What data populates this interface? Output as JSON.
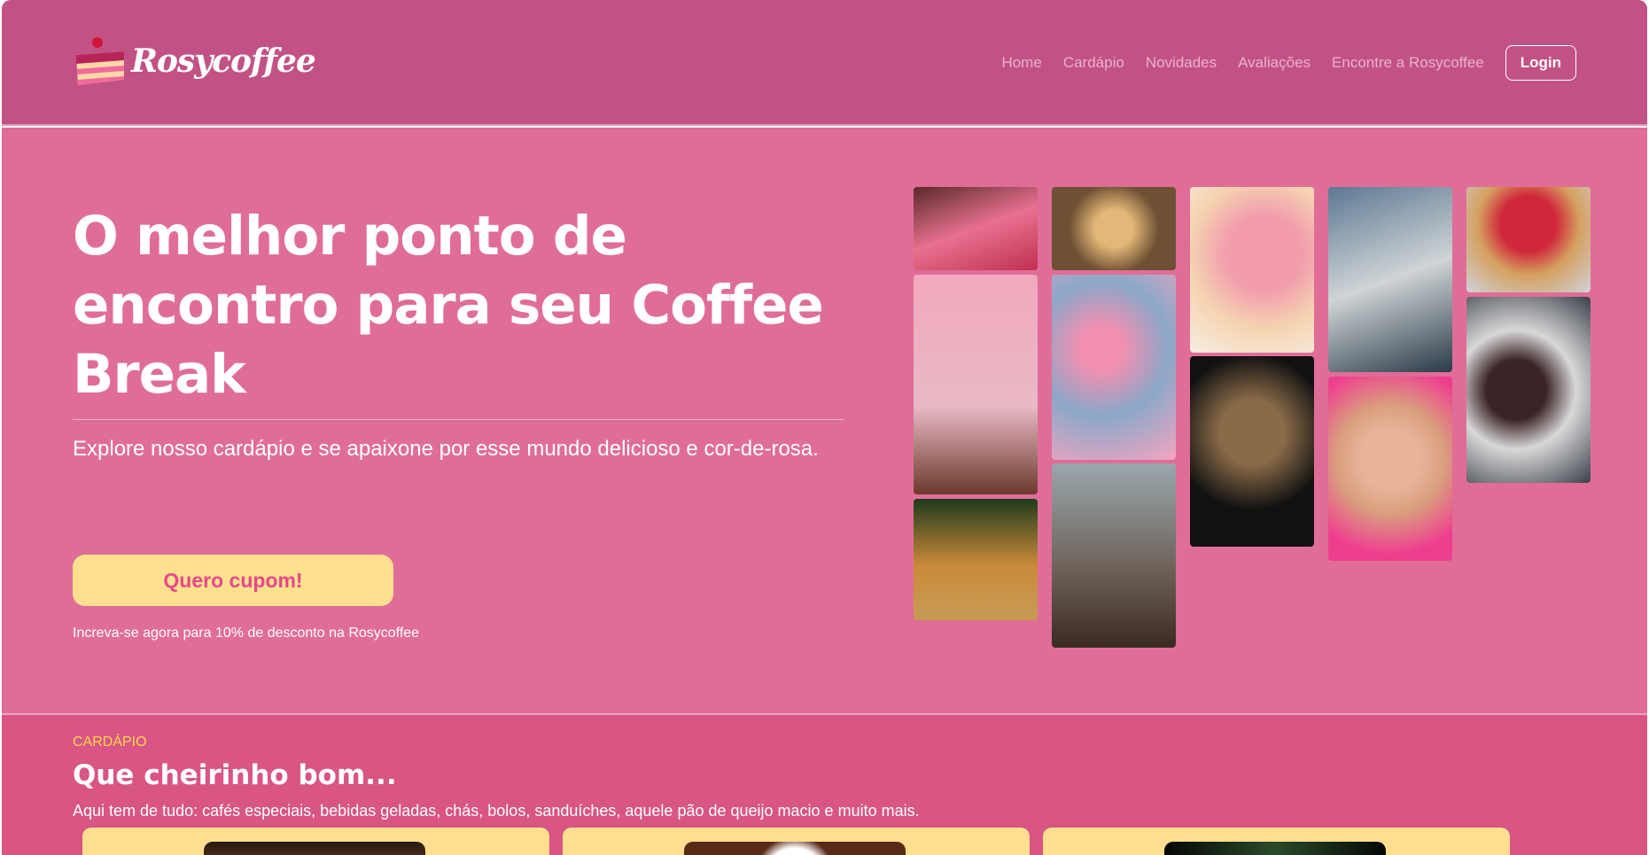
{
  "header": {
    "brand": "Rosycoffee",
    "nav": [
      "Home",
      "Cardápio",
      "Novidades",
      "Avaliações",
      "Encontre a Rosycoffee"
    ],
    "login": "Login"
  },
  "hero": {
    "title": "O melhor ponto de encontro para seu Coffee Break",
    "subtitle": "Explore nosso cardápio e se apaixone por esse mundo delicioso e cor-de-rosa.",
    "cta": "Quero cupom!",
    "note": "Increva-se agora para 10% de desconto na Rosycoffee"
  },
  "gallery": [
    "tartlets",
    "pink-drink",
    "croissant",
    "pie",
    "macarons",
    "woman-window",
    "cupcakes",
    "latte",
    "cake-slice",
    "pink-milkshake-girl",
    "strawberry-tart",
    "donuts"
  ],
  "menu": {
    "eyebrow": "CARDÁPIO",
    "title": "Que cheirinho bom...",
    "description": "Aqui tem de tudo: cafés especiais, bebidas geladas, chás, bolos, sanduíches, aquele pão de queijo macio e muito mais."
  },
  "colors": {
    "header": "#c25285",
    "hero": "#e06d98",
    "section": "#d85584",
    "accent": "#ffe08f"
  }
}
